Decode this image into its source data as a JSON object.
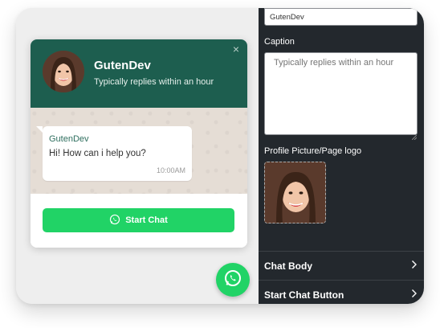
{
  "preview": {
    "header": {
      "title": "GutenDev",
      "caption": "Typically replies within an hour",
      "close_glyph": "×",
      "avatar": "profile-photo"
    },
    "body": {
      "sender": "GutenDev",
      "message": "Hi! How can i help you?",
      "time": "10:00AM",
      "background_color": "#e5ddd5"
    },
    "start_button": {
      "label": "Start Chat",
      "icon": "whatsapp-icon",
      "color": "#21d366"
    },
    "fab": {
      "icon": "whatsapp-icon",
      "color": "#21d366"
    },
    "header_color": "#1d5e4f"
  },
  "panel": {
    "title_input": {
      "value": "GutenDev"
    },
    "caption_label": "Caption",
    "caption_textarea": {
      "placeholder": "Typically replies within an hour"
    },
    "logo_label": "Profile Picture/Page logo",
    "sections": [
      {
        "label": "Chat Body"
      },
      {
        "label": "Start Chat Button"
      }
    ],
    "background_color": "#23282d"
  }
}
